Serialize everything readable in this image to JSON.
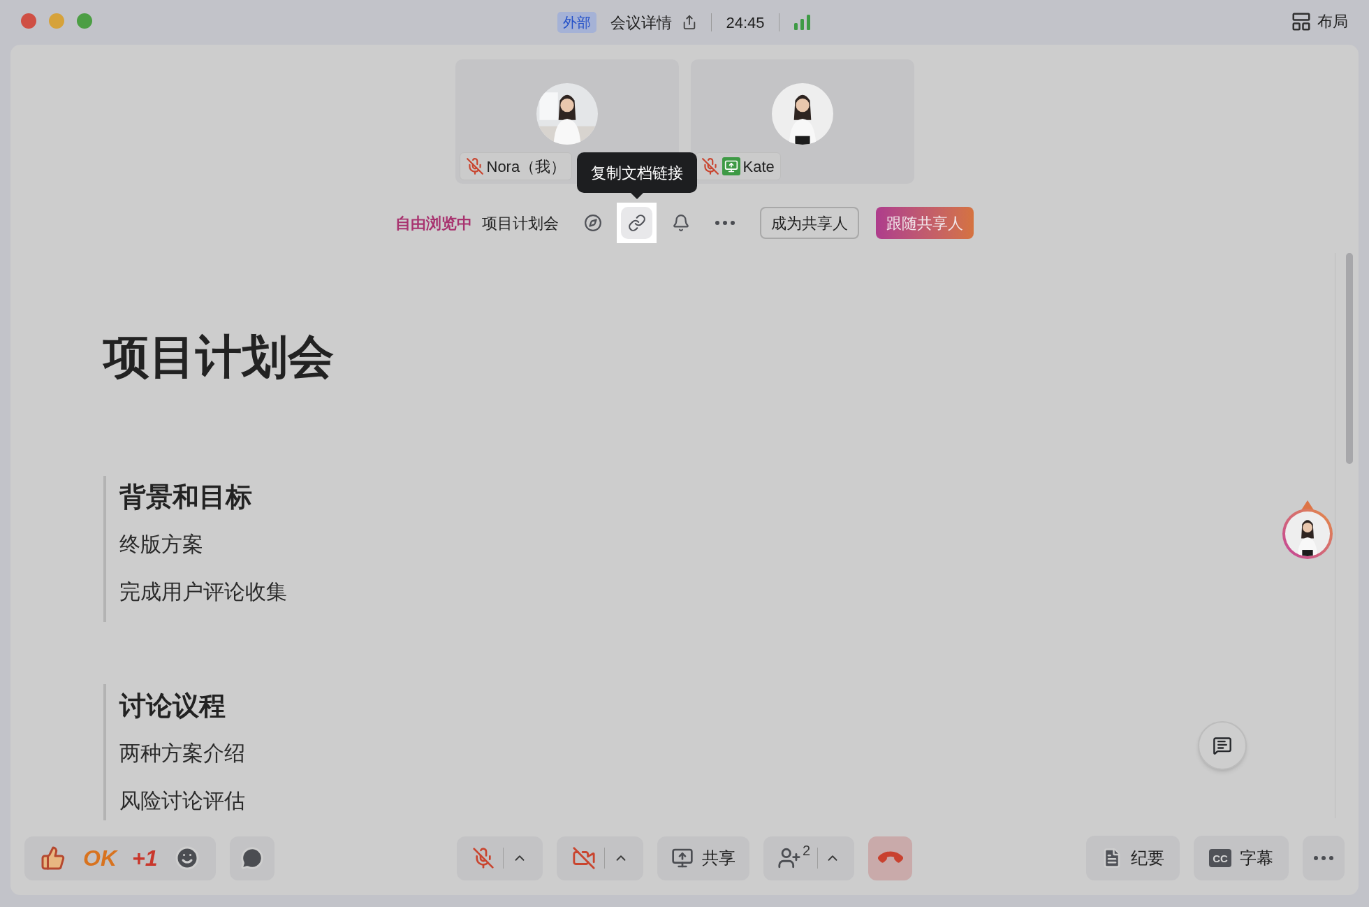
{
  "title_bar": {
    "badge": "外部",
    "title": "会议详情",
    "timer": "24:45",
    "layout_button": "布局"
  },
  "participants": [
    {
      "name": "Nora（我）",
      "muted": true,
      "sharing": false
    },
    {
      "name": "Kate",
      "muted": true,
      "sharing": true
    }
  ],
  "tooltip": "复制文档链接",
  "share_bar": {
    "status": "自由浏览中",
    "doc_title": "项目计划会",
    "become_presenter": "成为共享人",
    "follow_presenter": "跟随共享人"
  },
  "tools": [
    {
      "kind": "compass",
      "selected": false
    },
    {
      "kind": "link",
      "selected": true
    },
    {
      "kind": "bell",
      "selected": false
    },
    {
      "kind": "more",
      "selected": false
    }
  ],
  "document": {
    "title": "项目计划会",
    "sections": [
      {
        "heading": "背景和目标",
        "items": [
          "终版方案",
          "完成用户评论收集"
        ]
      },
      {
        "heading": "讨论议程",
        "items": [
          "两种方案介绍",
          "风险讨论评估"
        ]
      }
    ]
  },
  "reactions": [
    {
      "kind": "thumbs_up"
    },
    {
      "kind": "text",
      "label": "OK",
      "color": "#d8731f"
    },
    {
      "kind": "text",
      "label": "+1",
      "color": "#c9372c"
    },
    {
      "kind": "emoji"
    }
  ],
  "controls": {
    "mic_on": false,
    "camera_on": false,
    "share": "共享",
    "participant_count": "2"
  },
  "right_controls": [
    {
      "kind": "notes",
      "label": "纪要"
    },
    {
      "kind": "captions",
      "label": "字幕",
      "icon_text": "CC"
    }
  ]
}
